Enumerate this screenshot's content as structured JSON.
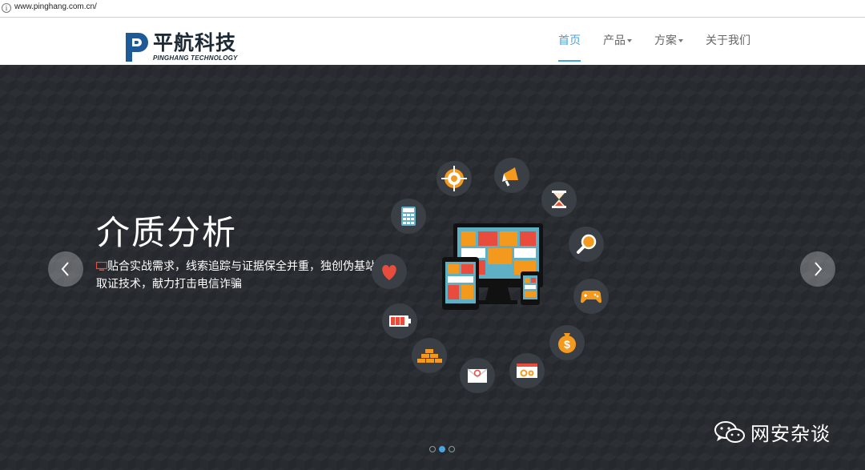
{
  "browser": {
    "url": "www.pinghang.com.cn/"
  },
  "site": {
    "logo_title": "平航科技",
    "logo_subtitle": "PINGHANG TECHNOLOGY",
    "nav": [
      {
        "label": "首页",
        "active": true,
        "dropdown": false
      },
      {
        "label": "产品",
        "active": false,
        "dropdown": true
      },
      {
        "label": "方案",
        "active": false,
        "dropdown": true
      },
      {
        "label": "关于我们",
        "active": false,
        "dropdown": false
      }
    ]
  },
  "hero": {
    "title": "介质分析",
    "description": "贴合实战需求，线索追踪与证据保全并重，独创伪基站取证技术，献力打击电信诈骗",
    "slides_total": 3,
    "active_slide": 2
  },
  "watermark": {
    "text": "网安杂谈"
  },
  "colors": {
    "accent": "#4aa3df",
    "hero_bg": "#25292d",
    "icon_bg": "#3a3f45",
    "orange": "#f39a1e",
    "red": "#e74c3c",
    "teal": "#5fb0c4"
  }
}
